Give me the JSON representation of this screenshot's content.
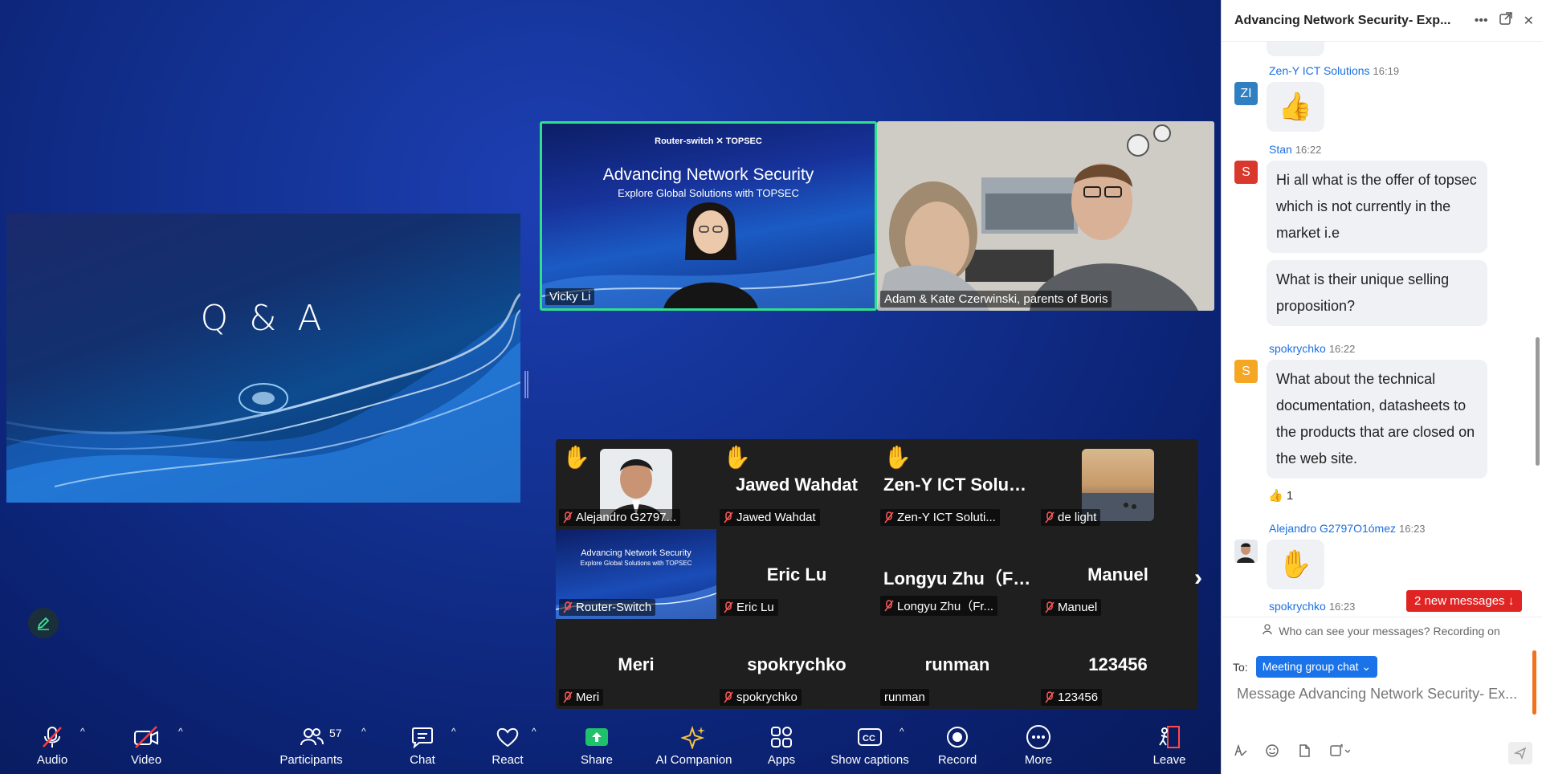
{
  "share": {
    "title": "Q & A"
  },
  "tiles": {
    "vicky": {
      "name": "Vicky Li",
      "brand": "Router-switch ✕ TOPSEC",
      "h1": "Advancing Network Security",
      "h2": "Explore Global Solutions with TOPSEC"
    },
    "adam": {
      "name": "Adam & Kate Czerwinski, parents of Boris"
    }
  },
  "gallery": [
    {
      "big": "",
      "label": "Alejandro G2797...",
      "hand": true,
      "photo": "person"
    },
    {
      "big": "Jawed Wahdat",
      "label": "Jawed Wahdat",
      "hand": true
    },
    {
      "big": "Zen-Y ICT Soluti...",
      "label": "Zen-Y ICT Soluti...",
      "hand": true
    },
    {
      "big": "",
      "label": "de light",
      "hand": false,
      "photo": "sunset"
    },
    {
      "big": "",
      "label": "Router-Switch",
      "hand": false,
      "photo": "slide",
      "slide_h1": "Advancing Network Security",
      "slide_h2": "Explore Global Solutions with TOPSEC"
    },
    {
      "big": "Eric Lu",
      "label": "Eric Lu",
      "hand": false
    },
    {
      "big": "Longyu Zhu（Fr...",
      "label": "Longyu Zhu（Fr...",
      "hand": false
    },
    {
      "big": "Manuel",
      "label": "Manuel",
      "hand": false
    },
    {
      "big": "Meri",
      "label": "Meri",
      "hand": false
    },
    {
      "big": "spokrychko",
      "label": "spokrychko",
      "hand": false
    },
    {
      "big": "runman",
      "label": "runman",
      "hand": false,
      "unmuted": true
    },
    {
      "big": "123456",
      "label": "123456",
      "hand": false
    }
  ],
  "toolbar": {
    "audio": "Audio",
    "video": "Video",
    "participants": "Participants",
    "participants_count": "57",
    "chat": "Chat",
    "react": "React",
    "share": "Share",
    "ai": "AI Companion",
    "apps": "Apps",
    "captions": "Show captions",
    "record": "Record",
    "more": "More",
    "leave": "Leave"
  },
  "chat": {
    "title": "Advancing Network Security- Exp...",
    "messages": [
      {
        "sender": "Zen-Y ICT Solutions",
        "time": "16:19",
        "avatar": "ZI",
        "avatar_color": "#2f7fc1"
      },
      {
        "sender": "Stan",
        "time": "16:22",
        "avatar": "S",
        "avatar_color": "#d9382c",
        "text1": "Hi all what is the offer of topsec which is not currently in the market i.e",
        "text2": "What is their unique selling proposition?"
      },
      {
        "sender": "spokrychko",
        "time": "16:22",
        "avatar": "S",
        "avatar_color": "#f5a623",
        "text1": "What about the technical documentation, datasheets to the products that are closed on the web site.",
        "reaction": "1"
      },
      {
        "sender": "Alejandro G2797O1ómez",
        "time": "16:23"
      },
      {
        "sender": "spokrychko",
        "time": "16:23"
      }
    ],
    "new_messages": "2 new messages",
    "privacy": "Who can see your messages? Recording on",
    "to_label": "To:",
    "to_value": "Meeting group chat",
    "placeholder": "Message Advancing Network Security- Ex..."
  }
}
